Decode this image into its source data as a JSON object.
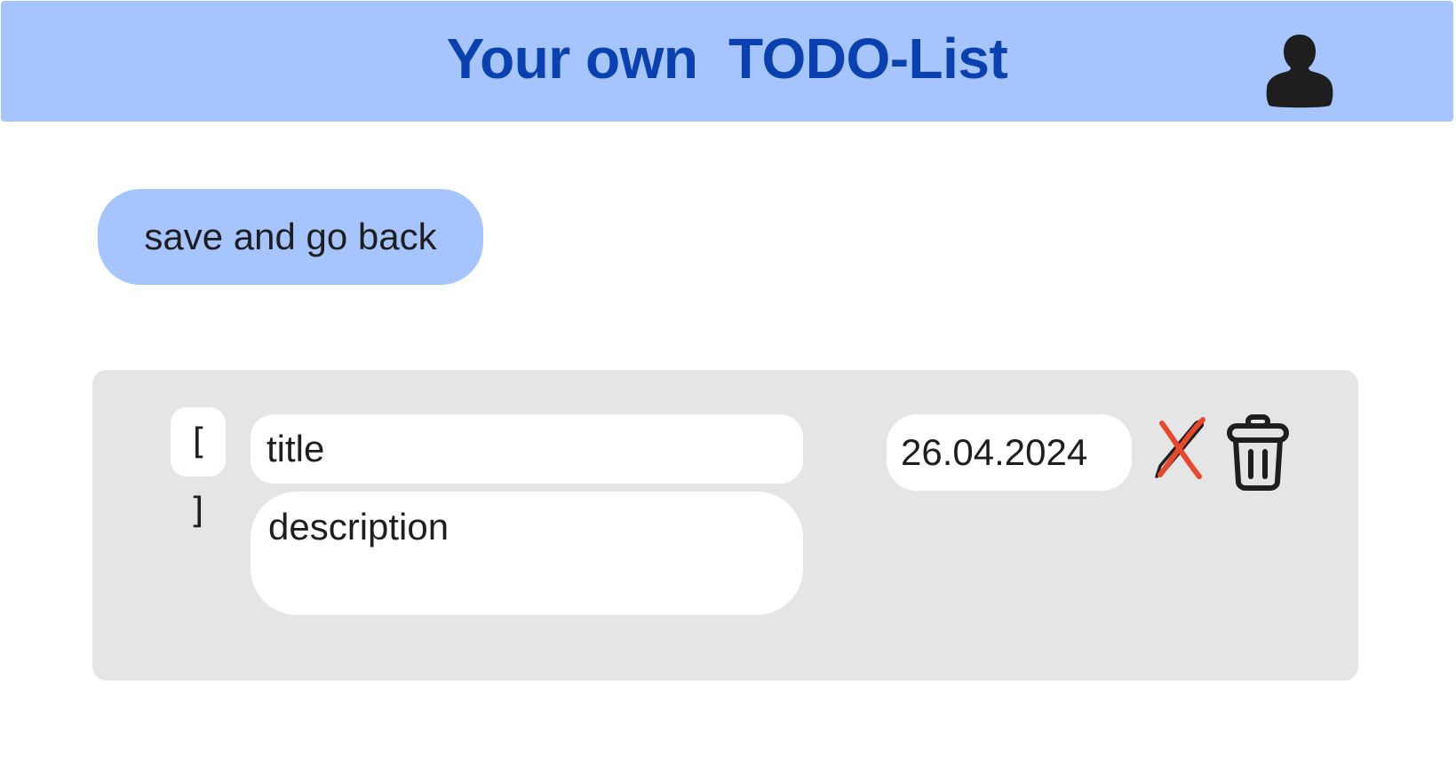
{
  "header": {
    "title": "Your own  TODO-List",
    "user_icon": "user-icon"
  },
  "actions": {
    "back_label": "save and go back"
  },
  "todo": {
    "checkbox": "[ ]",
    "title": "title",
    "description": "description",
    "date": "26.04.2024",
    "edit_icon": "pencil-crossed-icon",
    "delete_icon": "trash-icon"
  },
  "colors": {
    "header_bg": "#a6c4fd",
    "title_text": "#0a41b0",
    "card_bg": "#e5e5e5",
    "edit_cross": "#e8472c"
  }
}
